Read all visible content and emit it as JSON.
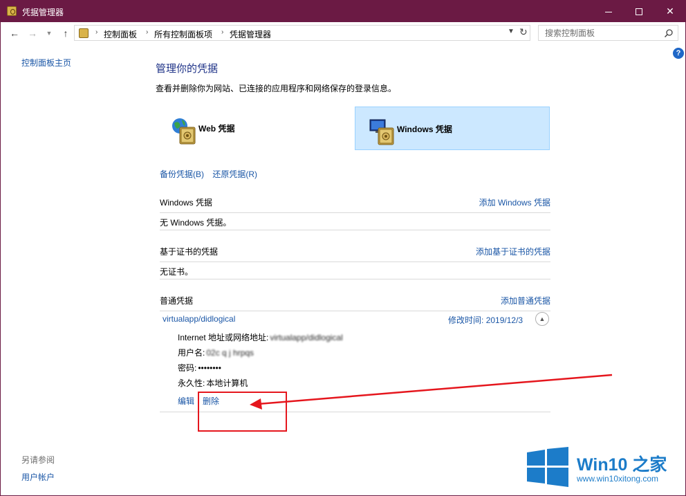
{
  "window": {
    "title": "凭据管理器",
    "accent_color": "#6b1a44"
  },
  "nav": {
    "breadcrumb": [
      "控制面板",
      "所有控制面板项",
      "凭据管理器"
    ],
    "search_placeholder": "搜索控制面板"
  },
  "sidebar": {
    "home": "控制面板主页",
    "see_also": "另请参阅",
    "user_accounts": "用户帐户"
  },
  "main": {
    "title": "管理你的凭据",
    "description": "查看并删除你为网站、已连接的应用程序和网络保存的登录信息。",
    "cred_types": [
      {
        "label": "Web 凭据",
        "icon": "globe-vault-icon",
        "selected": false
      },
      {
        "label": "Windows 凭据",
        "icon": "computer-vault-icon",
        "selected": true
      }
    ],
    "backup": "备份凭据(B)",
    "restore": "还原凭据(R)",
    "sections": {
      "windows": {
        "title": "Windows 凭据",
        "add": "添加 Windows 凭据",
        "body": "无 Windows 凭据。"
      },
      "cert": {
        "title": "基于证书的凭据",
        "add": "添加基于证书的凭据",
        "body": "无证书。"
      },
      "generic": {
        "title": "普通凭据",
        "add": "添加普通凭据"
      }
    },
    "credential": {
      "name": "virtualapp/didlogical",
      "modified_label": "修改时间:",
      "modified_date": "2019/12/3",
      "address_label": "Internet 地址或网络地址:",
      "address_value": "virtualapp/didlogical",
      "username_label": "用户名:",
      "username_value": "02c q j hrpqs",
      "password_label": "密码:",
      "password_value": "••••••••",
      "persistence_label": "永久性:",
      "persistence_value": "本地计算机",
      "edit": "编辑",
      "delete": "删除"
    }
  },
  "annotation": {
    "color": "#e5161d"
  },
  "watermark": {
    "brand": "Win10",
    "brand_zh": "之家",
    "url": "www.win10xitong.com",
    "color": "#1c7cc9"
  }
}
